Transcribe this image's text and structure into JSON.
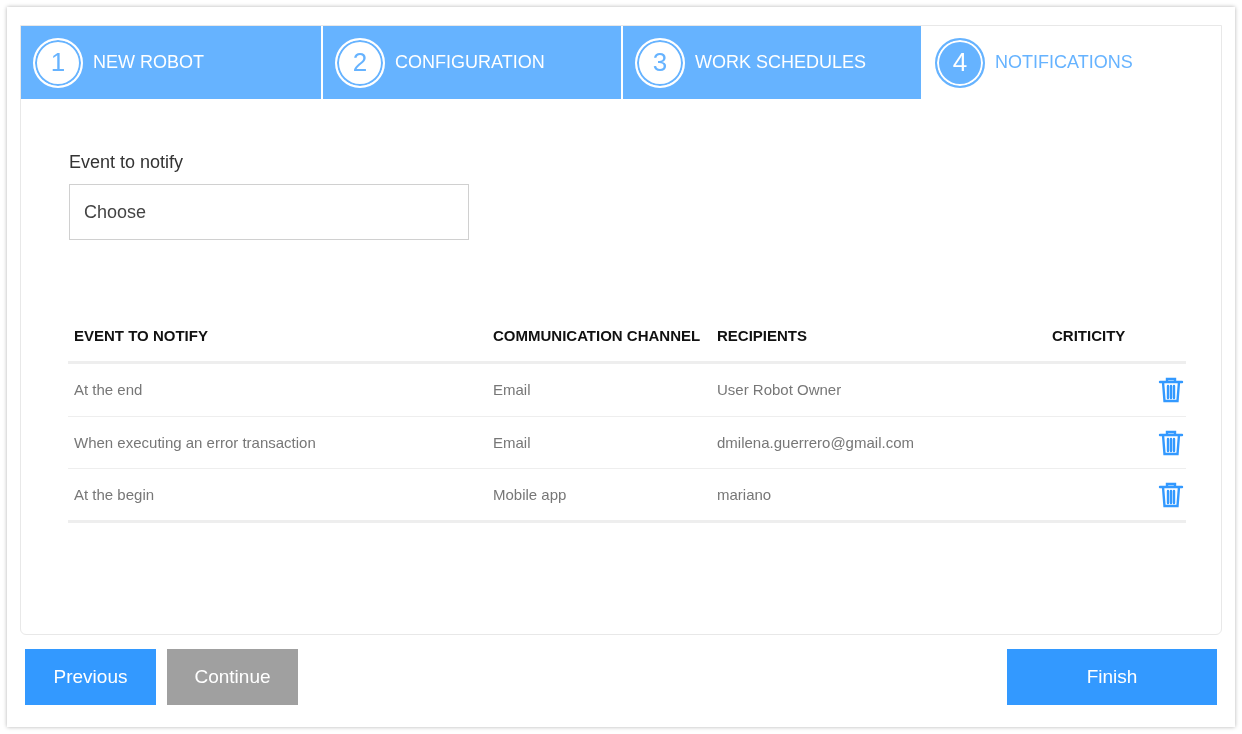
{
  "steps": [
    {
      "number": "1",
      "label": "NEW ROBOT",
      "selected": false
    },
    {
      "number": "2",
      "label": "CONFIGURATION",
      "selected": false
    },
    {
      "number": "3",
      "label": "WORK SCHEDULES",
      "selected": false
    },
    {
      "number": "4",
      "label": "NOTIFICATIONS",
      "selected": true
    }
  ],
  "event_field": {
    "label": "Event to notify",
    "placeholder": "Choose"
  },
  "table": {
    "columns": [
      "EVENT TO NOTIFY",
      "COMMUNICATION CHANNEL",
      "RECIPIENTS",
      "CRITICITY"
    ],
    "rows": [
      [
        "At the end",
        "Email",
        "User Robot Owner"
      ],
      [
        "When executing an error transaction",
        "Email",
        "dmilena.guerrero@gmail.com"
      ],
      [
        "At the begin",
        "Mobile app",
        "mariano"
      ]
    ]
  },
  "buttons": [
    {
      "label": "Previous",
      "disabled": false
    },
    {
      "label": "Continue",
      "disabled": true
    },
    {
      "label": "Finish",
      "disabled": false
    }
  ]
}
